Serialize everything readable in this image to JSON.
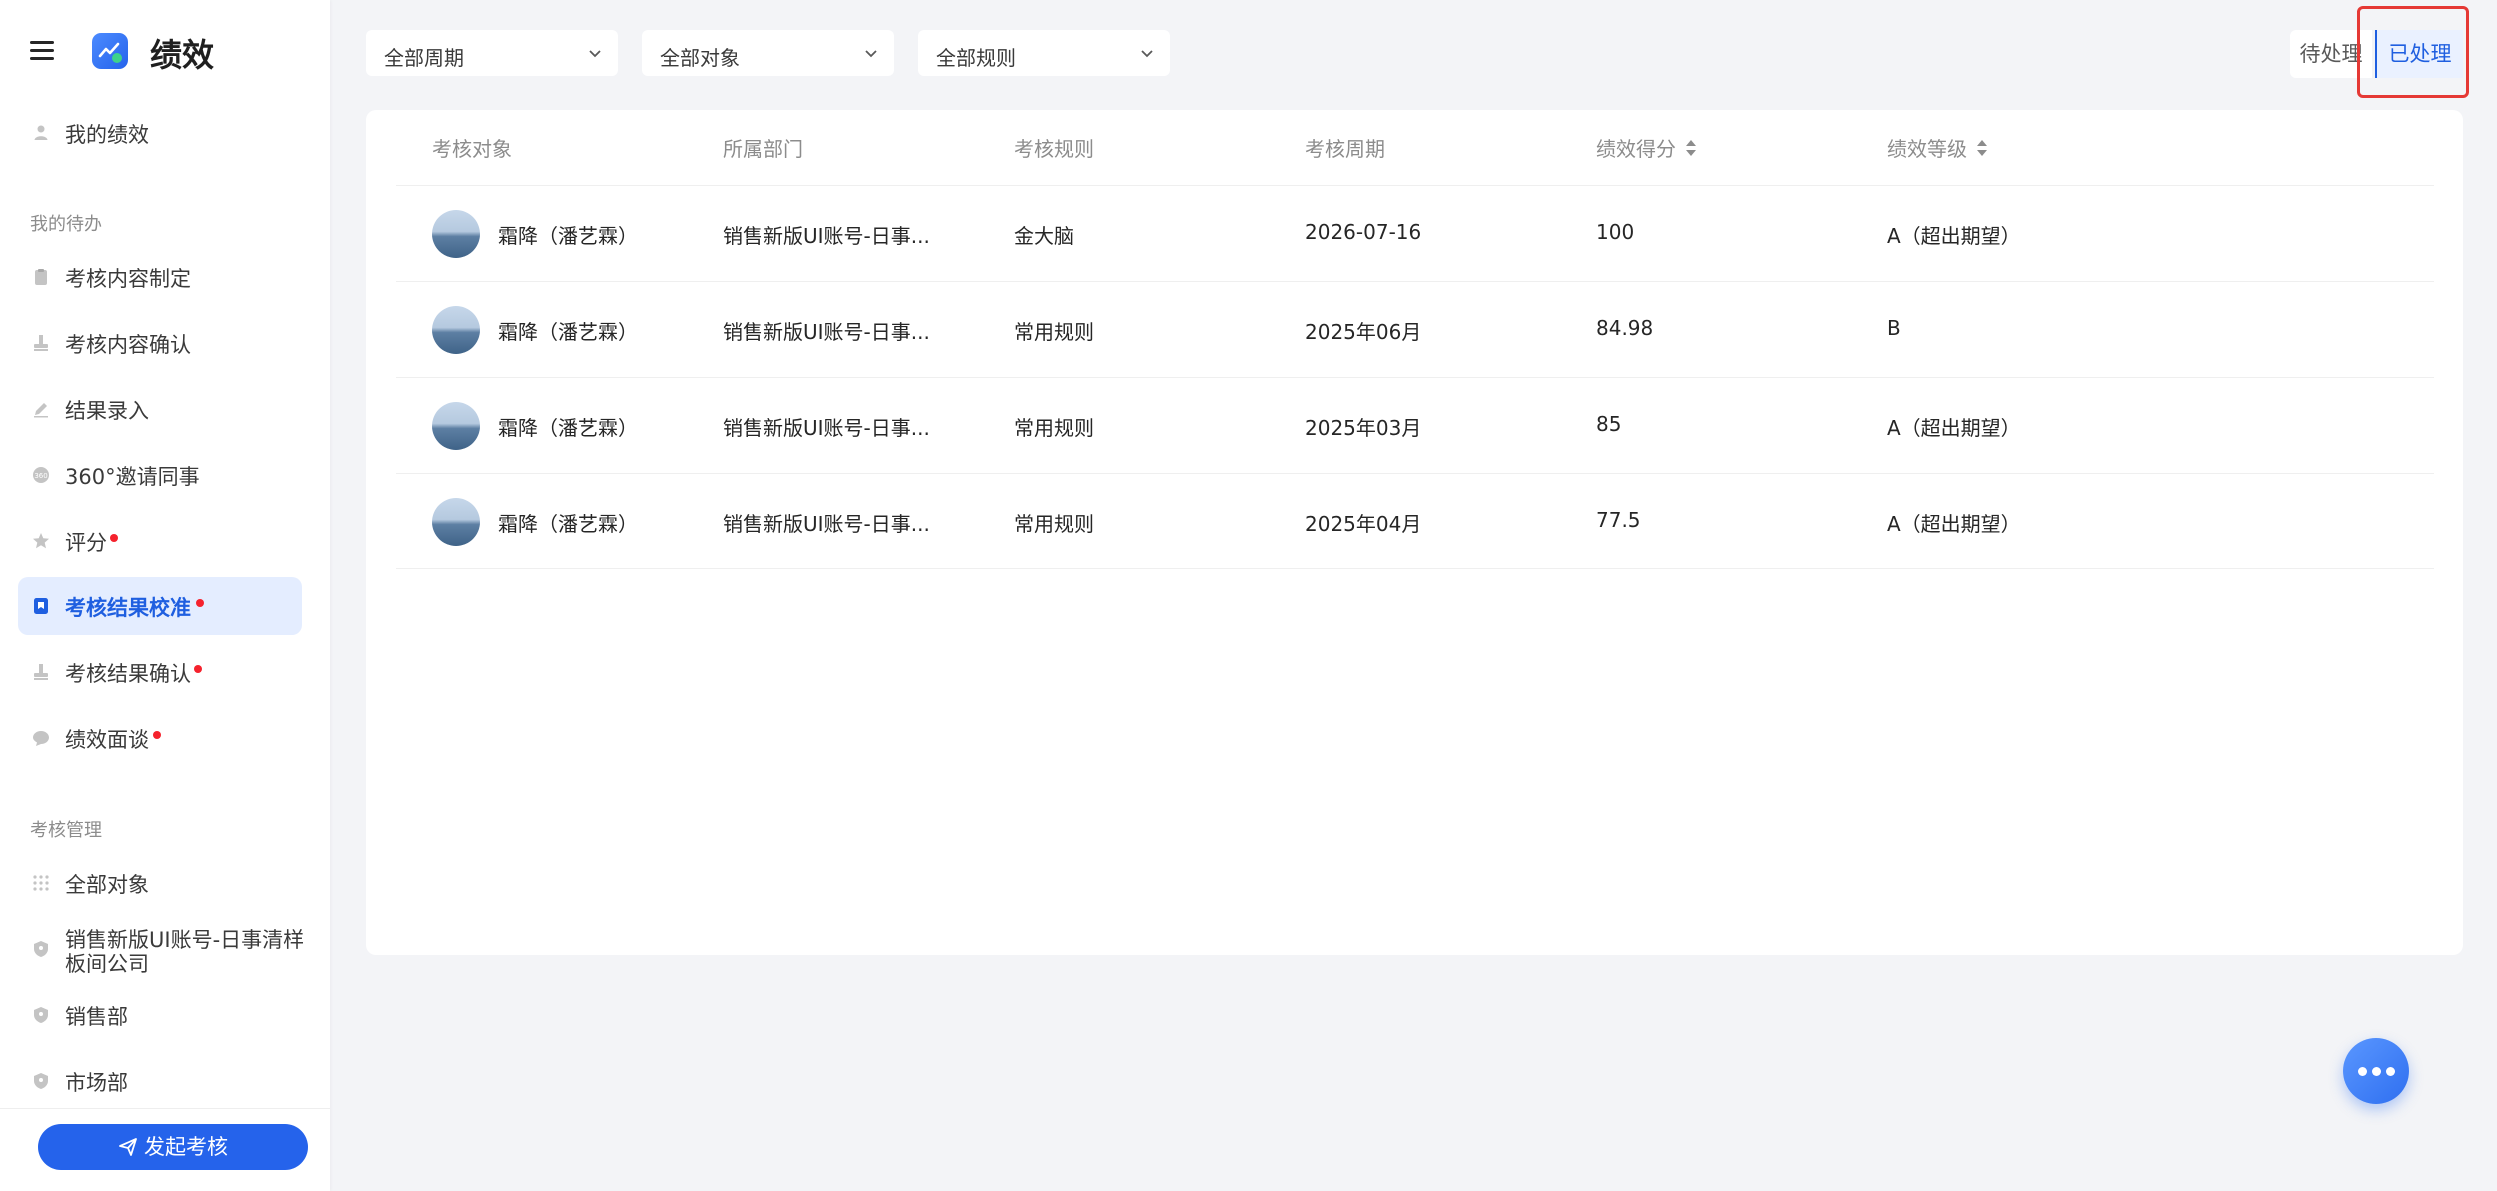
{
  "app": {
    "title": "绩效"
  },
  "sidebar": {
    "my_performance": "我的绩效",
    "todo_section": "我的待办",
    "todo_items": [
      {
        "label": "考核内容制定",
        "icon": "clipboard-icon",
        "dot": false
      },
      {
        "label": "考核内容确认",
        "icon": "stamp-icon",
        "dot": false
      },
      {
        "label": "结果录入",
        "icon": "pen-icon",
        "dot": false
      },
      {
        "label": "360°邀请同事",
        "icon": "360-icon",
        "dot": false
      },
      {
        "label": "评分",
        "icon": "star-icon",
        "dot": true
      },
      {
        "label": "考核结果校准",
        "icon": "bookmark-icon",
        "dot": true,
        "active": true
      },
      {
        "label": "考核结果确认",
        "icon": "stamp-icon",
        "dot": true
      },
      {
        "label": "绩效面谈",
        "icon": "chat-icon",
        "dot": true
      }
    ],
    "manage_section": "考核管理",
    "manage_items": [
      {
        "label": "全部对象",
        "icon": "grid-icon"
      },
      {
        "label": "销售新版UI账号-日事清样板间公司",
        "icon": "org-icon"
      },
      {
        "label": "销售部",
        "icon": "org-icon"
      },
      {
        "label": "市场部",
        "icon": "org-icon"
      }
    ],
    "launch_button": "发起考核"
  },
  "filters": {
    "period": "全部周期",
    "target": "全部对象",
    "rule": "全部规则"
  },
  "tabs": {
    "pending": "待处理",
    "done": "已处理"
  },
  "table": {
    "headers": [
      "考核对象",
      "所属部门",
      "考核规则",
      "考核周期",
      "绩效得分",
      "绩效等级"
    ],
    "rows": [
      {
        "name": "霜降（潘艺霖）",
        "dept": "销售新版UI账号-日事...",
        "rule": "金大脑",
        "period": "2026-07-16",
        "score": "100",
        "grade": "A（超出期望）"
      },
      {
        "name": "霜降（潘艺霖）",
        "dept": "销售新版UI账号-日事...",
        "rule": "常用规则",
        "period": "2025年06月",
        "score": "84.98",
        "grade": "B"
      },
      {
        "name": "霜降（潘艺霖）",
        "dept": "销售新版UI账号-日事...",
        "rule": "常用规则",
        "period": "2025年03月",
        "score": "85",
        "grade": "A（超出期望）"
      },
      {
        "name": "霜降（潘艺霖）",
        "dept": "销售新版UI账号-日事...",
        "rule": "常用规则",
        "period": "2025年04月",
        "score": "77.5",
        "grade": "A（超出期望）"
      }
    ]
  },
  "colors": {
    "accent": "#2563eb",
    "active_bg": "#e4edff",
    "dot": "#f5222d",
    "highlight": "#e53935"
  }
}
